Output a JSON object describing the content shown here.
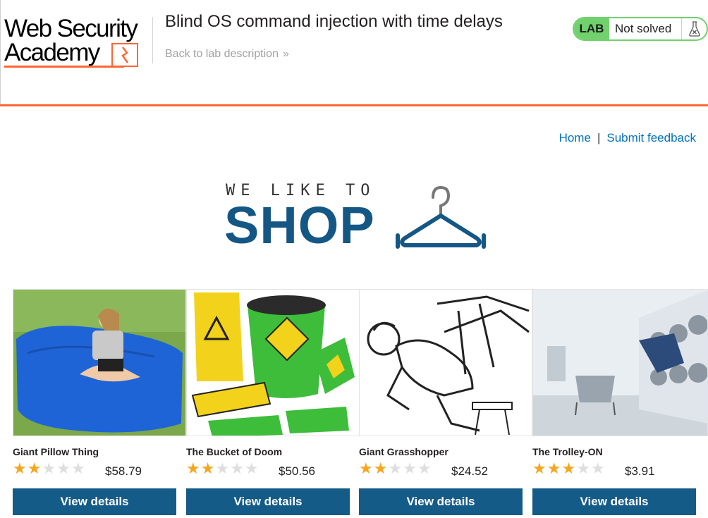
{
  "academy": {
    "logo_line1": "Web Security",
    "logo_line2": "Academy",
    "lab_title": "Blind OS command injection with time delays",
    "back_link": "Back to lab description",
    "back_link_chevron": "»",
    "lab_badge": "LAB",
    "status": "Not solved",
    "accent_color": "#ff6633",
    "status_color": "#70d16d"
  },
  "nav": {
    "home": "Home",
    "separator": "|",
    "feedback": "Submit feedback"
  },
  "hero": {
    "tagline": "WE LIKE TO",
    "title": "SHOP",
    "icon": "hanger-icon"
  },
  "products": [
    {
      "name": "Giant Pillow Thing",
      "rating": 2,
      "max_rating": 5,
      "price": "$58.79",
      "button": "View details"
    },
    {
      "name": "The Bucket of Doom",
      "rating": 2,
      "max_rating": 5,
      "price": "$50.56",
      "button": "View details"
    },
    {
      "name": "Giant Grasshopper",
      "rating": 2,
      "max_rating": 5,
      "price": "$24.52",
      "button": "View details"
    },
    {
      "name": "The Trolley-ON",
      "rating": 3,
      "max_rating": 5,
      "price": "$3.91",
      "button": "View details"
    }
  ],
  "colors": {
    "primary_button": "#155b88",
    "link": "#0071bc",
    "star_on": "#f5a61c",
    "star_off": "#dedede"
  }
}
